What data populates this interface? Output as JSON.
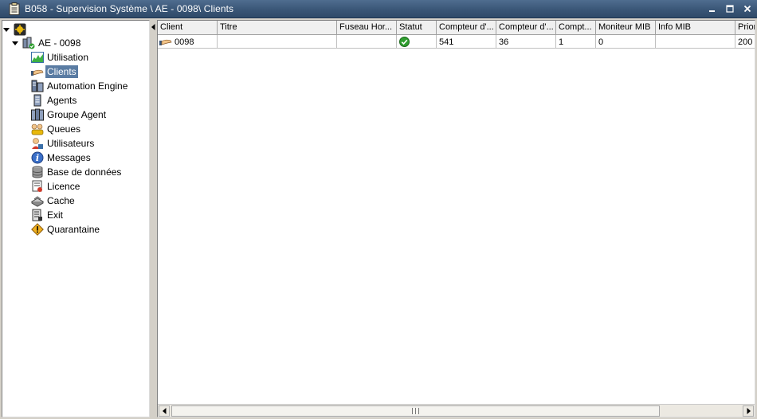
{
  "window": {
    "title": "B058 - Supervision Système \\ AE - 0098\\ Clients"
  },
  "tree": {
    "system": {
      "label": "AE - 0098",
      "items": [
        {
          "label": "Utilisation",
          "icon": "chart-icon"
        },
        {
          "label": "Clients",
          "icon": "client-icon",
          "selected": true
        },
        {
          "label": "Automation Engine",
          "icon": "server-icon"
        },
        {
          "label": "Agents",
          "icon": "agent-icon"
        },
        {
          "label": "Groupe Agent",
          "icon": "agent-group-icon"
        },
        {
          "label": "Queues",
          "icon": "queues-icon"
        },
        {
          "label": "Utilisateurs",
          "icon": "users-icon"
        },
        {
          "label": "Messages",
          "icon": "info-icon"
        },
        {
          "label": "Base de données",
          "icon": "database-icon"
        },
        {
          "label": "Licence",
          "icon": "license-icon"
        },
        {
          "label": "Cache",
          "icon": "cache-icon"
        },
        {
          "label": "Exit",
          "icon": "exit-icon"
        },
        {
          "label": "Quarantaine",
          "icon": "warning-icon"
        }
      ]
    }
  },
  "grid": {
    "columns": [
      {
        "label": "Client"
      },
      {
        "label": "Titre"
      },
      {
        "label": "Fuseau Hor..."
      },
      {
        "label": "Statut"
      },
      {
        "label": "Compteur d'..."
      },
      {
        "label": "Compteur d'..."
      },
      {
        "label": "Compt..."
      },
      {
        "label": "Moniteur MIB"
      },
      {
        "label": "Info MIB"
      },
      {
        "label": "Prior"
      }
    ],
    "rows": [
      {
        "client": "0098",
        "titre": "",
        "fuseau": "",
        "statut": "ok",
        "c1": "541",
        "c2": "36",
        "c3": "1",
        "moniteur": "0",
        "info": "",
        "prior": "200"
      }
    ]
  },
  "colors": {
    "titlebar": "#3a5677",
    "selection": "#5a7ca3",
    "status_ok": "#2f9e2f"
  }
}
